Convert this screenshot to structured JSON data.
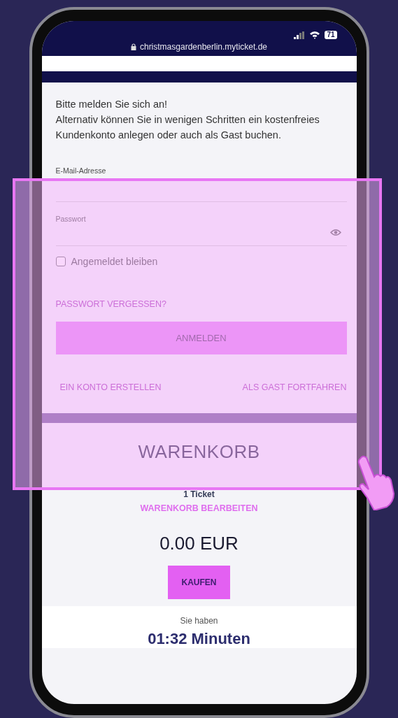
{
  "status_bar": {
    "battery": "71"
  },
  "address_bar": {
    "url": "christmasgardenberlin.myticket.de"
  },
  "login": {
    "intro": [
      "Bitte melden Sie sich an!",
      "Alternativ können Sie in wenigen Schritten ein kostenfreies Kundenkonto anlegen oder auch als Gast buchen."
    ],
    "fields": [
      {
        "kind": "email",
        "label": "E-Mail-Adresse"
      },
      {
        "kind": "password",
        "label": "Passwort"
      }
    ],
    "remember": {
      "label": "Angemeldet bleiben",
      "checked": false
    },
    "forgot_link": "PASSWORT VERGESSEN?",
    "submit": "ANMELDEN",
    "links": [
      "EIN KONTO ERSTELLEN",
      "ALS GAST FORTFAHREN"
    ]
  },
  "cart": {
    "title": "WARENKORB",
    "count": "1 Ticket",
    "edit_link": "WARENKORB BEARBEITEN",
    "total": "0.00 EUR",
    "buy": "KAUFEN"
  },
  "timer": {
    "label": "Sie haben",
    "time": "01:32 Minuten"
  }
}
